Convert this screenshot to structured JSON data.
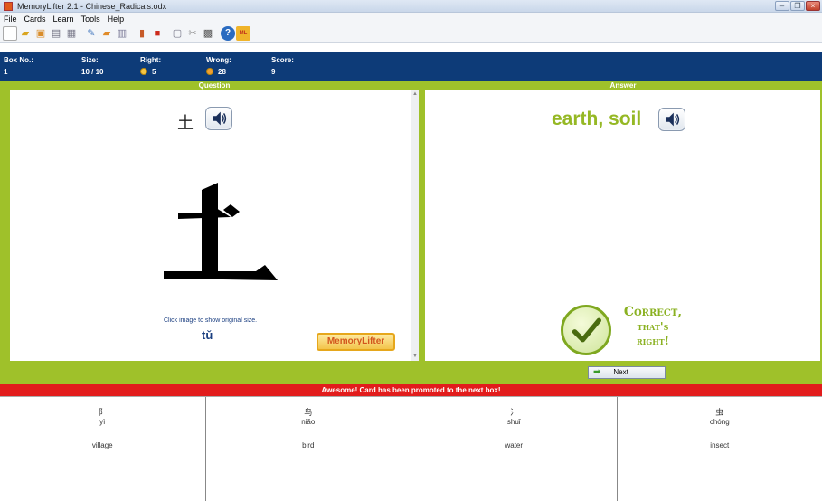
{
  "window": {
    "title": "MemoryLifter 2.1 - Chinese_Radicals.odx",
    "buttons": [
      "minimize",
      "maximize",
      "close"
    ]
  },
  "menu": [
    "File",
    "Cards",
    "Learn",
    "Tools",
    "Help"
  ],
  "toolbar_icons": [
    "new-document-icon",
    "open-folder-icon",
    "save-icon",
    "print-icon",
    "print-preview-icon",
    "edit-icon",
    "folder-icon",
    "card-icon",
    "book-icon",
    "stop-icon",
    "window-icon",
    "tools-icon",
    "screen-icon",
    "help-icon",
    "ml-icon"
  ],
  "stats": {
    "box_label": "Box No.:",
    "box_value": "1",
    "size_label": "Size:",
    "size_value": "10 / 10",
    "right_label": "Right:",
    "right_value": "5",
    "wrong_label": "Wrong:",
    "wrong_value": "28",
    "score_label": "Score:",
    "score_value": "9"
  },
  "question": {
    "header": "Question",
    "radical": "土",
    "hint": "Click image to show original size.",
    "pinyin": "tǔ",
    "logo_text": "MemoryLifter"
  },
  "answer": {
    "header": "Answer",
    "text": "earth, soil",
    "correct_line1": "Correct,",
    "correct_line2": "that's",
    "correct_line3": "right!"
  },
  "nav": {
    "next_label": "Next"
  },
  "promo_message": "Awesome! Card has been promoted to the next box!",
  "cards": [
    {
      "hanzi": "阝",
      "pinyin": "yì",
      "meaning": "village"
    },
    {
      "hanzi": "鸟",
      "pinyin": "niǎo",
      "meaning": "bird"
    },
    {
      "hanzi": "氵",
      "pinyin": "shuǐ",
      "meaning": "water"
    },
    {
      "hanzi": "虫",
      "pinyin": "chóng",
      "meaning": "insect"
    }
  ]
}
